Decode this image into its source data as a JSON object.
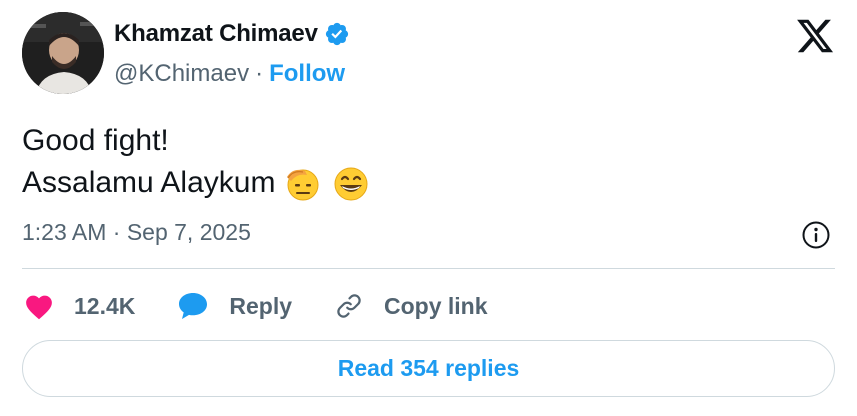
{
  "author": {
    "display_name": "Khamzat Chimaev",
    "handle": "@KChimaev",
    "separator": "·",
    "follow_label": "Follow",
    "verified": true
  },
  "tweet": {
    "line1": "Good fight!",
    "line2": "Assalamu Alaykum",
    "emojis": [
      "saluting-face-emoji",
      "grinning-face-emoji"
    ],
    "timestamp": "1:23 AM · Sep 7, 2025"
  },
  "actions": {
    "likes_count": "12.4K",
    "reply_label": "Reply",
    "copy_link_label": "Copy link"
  },
  "replies_button": {
    "label": "Read 354 replies"
  },
  "colors": {
    "accent": "#1d9bf0",
    "like": "#f91880",
    "text_primary": "#0f1419",
    "text_secondary": "#536471",
    "border": "#cfd9de"
  },
  "icons": {
    "brand": "x-logo-icon",
    "verified": "verified-badge-icon",
    "info": "info-icon",
    "like": "heart-icon",
    "reply": "speech-bubble-icon",
    "copy": "link-icon"
  }
}
